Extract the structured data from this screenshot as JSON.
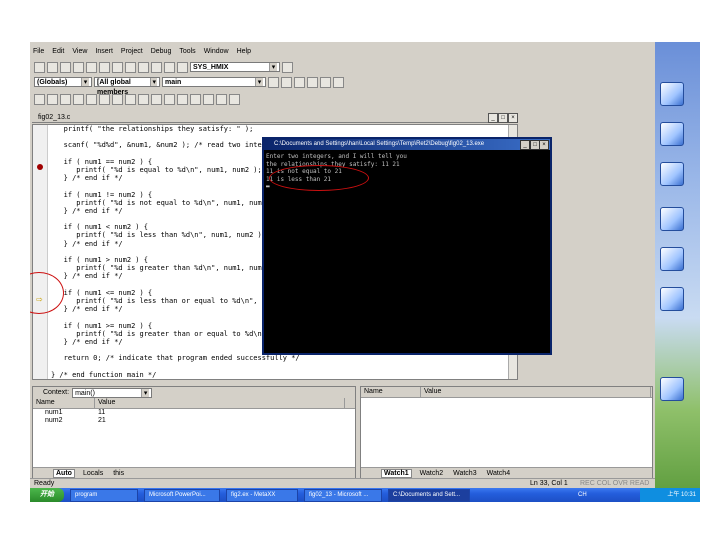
{
  "menu": [
    "File",
    "Edit",
    "View",
    "Insert",
    "Project",
    "Debug",
    "Tools",
    "Window",
    "Help"
  ],
  "toolbar": {
    "build_combo": "SYS_HMIX",
    "scope_combo": "(Globals)",
    "members_combo": "[All global members",
    "function_combo": "main"
  },
  "editor": {
    "title": "fig02_13.c",
    "lines": [
      "   printf( \"the relationships they satisfy: \" );",
      "",
      "   scanf( \"%d%d\", &num1, &num2 ); /* read two integers */",
      "",
      "   if ( num1 == num2 ) {",
      "      printf( \"%d is equal to %d\\n\", num1, num2 );",
      "   } /* end if */",
      "",
      "   if ( num1 != num2 ) {",
      "      printf( \"%d is not equal to %d\\n\", num1, num2 );",
      "   } /* end if */",
      "",
      "   if ( num1 < num2 ) {",
      "      printf( \"%d is less than %d\\n\", num1, num2 );",
      "   } /* end if */",
      "",
      "   if ( num1 > num2 ) {",
      "      printf( \"%d is greater than %d\\n\", num1, num2 );",
      "   } /* end if */",
      "",
      "   if ( num1 <= num2 ) {",
      "      printf( \"%d is less than or equal to %d\\n\", num1, nu",
      "   } /* end if */",
      "",
      "   if ( num1 >= num2 ) {",
      "      printf( \"%d is greater than or equal to %d\\n\", num1,",
      "   } /* end if */",
      "",
      "   return 0; /* indicate that program ended successfully */",
      "",
      "} /* end function main */"
    ]
  },
  "console": {
    "title": "C:\\Documents and Settings\\han\\Local Settings\\Temp\\Ret2\\Debug\\fig02_13.exe",
    "lines": [
      "Enter two integers, and I will tell you",
      "the relationships they satisfy: 11 21",
      "11 is not equal to 21",
      "11 is less than 21"
    ]
  },
  "locals": {
    "context_label": "Context:",
    "context_value": "main()",
    "col_name": "Name",
    "col_value": "Value",
    "rows": [
      {
        "name": "num1",
        "value": "11"
      },
      {
        "name": "num2",
        "value": "21"
      }
    ],
    "tabs": [
      "Auto",
      "Locals",
      "this"
    ]
  },
  "watch": {
    "col_name": "Name",
    "col_value": "Value",
    "tabs": [
      "Watch1",
      "Watch2",
      "Watch3",
      "Watch4"
    ]
  },
  "status": {
    "left": "Ready",
    "position": "Ln 33, Col 1",
    "flags": "REC COL OVR READ"
  },
  "taskbar": {
    "start": "开始",
    "tasks": [
      "program",
      "Microsoft PowerPoi...",
      "fig2.ex - MetaXX",
      "fig02_13 - Microsoft ...",
      "C:\\Documents and Sett..."
    ],
    "lang": "CH",
    "clock": "上午 10:31"
  },
  "colors": {
    "breakpoint": "#a00000",
    "annotation": "#cc1010",
    "titlebar": "#0a246a"
  }
}
